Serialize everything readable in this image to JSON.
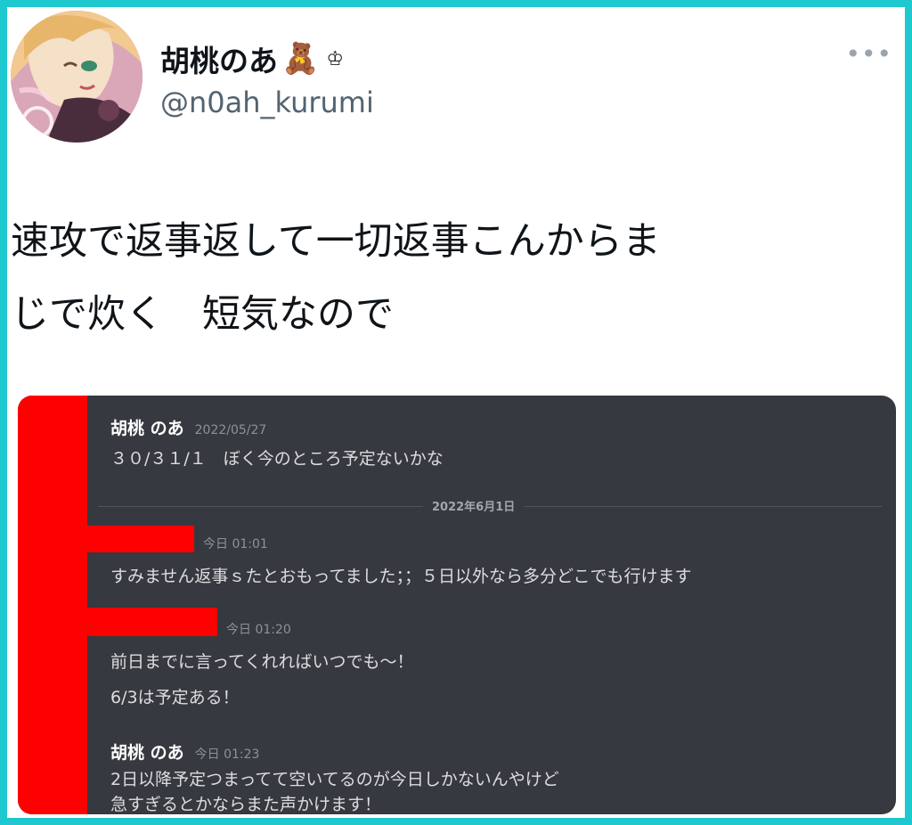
{
  "profile": {
    "display_name": "胡桃のあ",
    "emoji_bear": "🧸",
    "emoji_crown": "♔",
    "handle": "@n0ah_kurumi",
    "more_label": "•••"
  },
  "tweet": {
    "line1": "速攻で返事返して一切返事こんからま",
    "line2": "じで炊く　短気なので"
  },
  "chat": {
    "messages": [
      {
        "author": "胡桃 のあ",
        "time": "2022/05/27",
        "lines": [
          "３０/３１/１　ぼく今のところ予定ないかな"
        ]
      },
      {
        "author": "",
        "time": "今日 01:01",
        "lines": [
          "すみません返事ｓたとおもってました；；５日以外なら多分どこでも行けます"
        ]
      },
      {
        "author": "",
        "time": "今日 01:20",
        "lines": [
          "前日までに言ってくれればいつでも〜！",
          "6/3は予定ある！"
        ]
      },
      {
        "author": "胡桃 のあ",
        "time": "今日 01:23",
        "lines": [
          "2日以降予定つまってて空いてるのが今日しかないんやけど",
          "急すぎるとかならまた声かけます！"
        ]
      }
    ],
    "date_divider": "2022年6月1日"
  },
  "colors": {
    "frame": "#1ec8cf",
    "chat_bg": "#36393f",
    "redaction": "#ff0000"
  }
}
